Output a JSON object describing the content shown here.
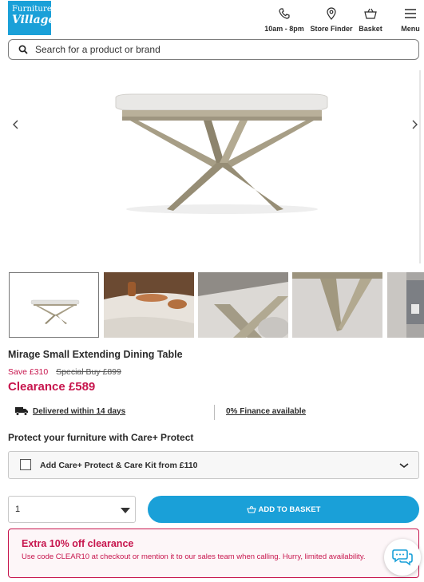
{
  "header": {
    "logo_line1": "Furniture",
    "logo_line2": "Village",
    "phone_label": "10am - 8pm",
    "store_finder_label": "Store Finder",
    "basket_label": "Basket",
    "menu_label": "Menu"
  },
  "search": {
    "placeholder": "Search for a product or brand"
  },
  "product": {
    "title": "Mirage Small Extending Dining Table",
    "save": "Save £310",
    "special_buy": "Special Buy £899",
    "clearance": "Clearance £589",
    "delivery": "Delivered within 14 days",
    "finance": "0% Finance available"
  },
  "care": {
    "heading": "Protect your furniture with Care+ Protect",
    "option_label": "Add Care+ Protect & Care Kit from £110",
    "checked": false
  },
  "purchase": {
    "quantity": "1",
    "add_to_basket": "ADD TO BASKET"
  },
  "promo": {
    "heading": "Extra 10% off clearance",
    "text": "Use code CLEAR10 at checkout or mention it to our sales team when calling. Hurry, limited availability."
  },
  "gallery": {
    "thumbnail_count": 5,
    "selected_index": 0
  },
  "colors": {
    "brand_blue": "#1aa0d8",
    "clearance_red": "#c7154d"
  }
}
